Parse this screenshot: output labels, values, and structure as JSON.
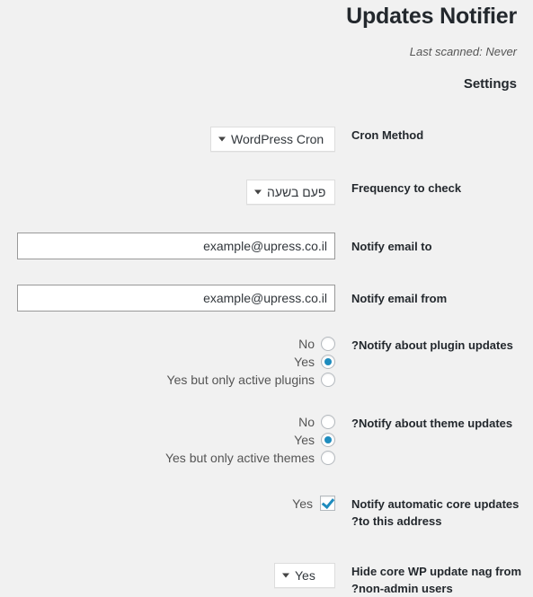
{
  "header": {
    "title": "Updates Notifier",
    "last_scanned": "Last scanned: Never",
    "settings_heading": "Settings"
  },
  "form": {
    "cron_method": {
      "label": "Cron Method",
      "value": "WordPress Cron",
      "arrow_icon": "chevron-down-icon"
    },
    "frequency": {
      "label": "Frequency to check",
      "value": "פעם בשעה",
      "arrow_icon": "chevron-down-icon"
    },
    "notify_email_to": {
      "label": "Notify email to",
      "value": "example@upress.co.il",
      "placeholder": ""
    },
    "notify_email_from": {
      "label": "Notify email from",
      "value": "example@upress.co.il",
      "placeholder": ""
    },
    "plugin_updates": {
      "label": "Notify about plugin updates?",
      "options": [
        {
          "label": "No",
          "checked": false
        },
        {
          "label": "Yes",
          "checked": true
        },
        {
          "label": "Yes but only active plugins",
          "checked": false
        }
      ]
    },
    "theme_updates": {
      "label": "Notify about theme updates?",
      "options": [
        {
          "label": "No",
          "checked": false
        },
        {
          "label": "Yes",
          "checked": true
        },
        {
          "label": "Yes but only active themes",
          "checked": false
        }
      ]
    },
    "core_updates": {
      "label": "Notify automatic core updates to this address?",
      "option_label": "Yes",
      "checked": true
    },
    "hide_nag": {
      "label": "Hide core WP update nag from non-admin users?",
      "value": "Yes",
      "arrow_icon": "chevron-down-icon"
    }
  },
  "colors": {
    "background": "#f1f1f1",
    "accent": "#1e8cbe",
    "heading": "#23282d",
    "body_text": "#555555",
    "input_border": "#999999",
    "select_border": "#dddddd"
  }
}
